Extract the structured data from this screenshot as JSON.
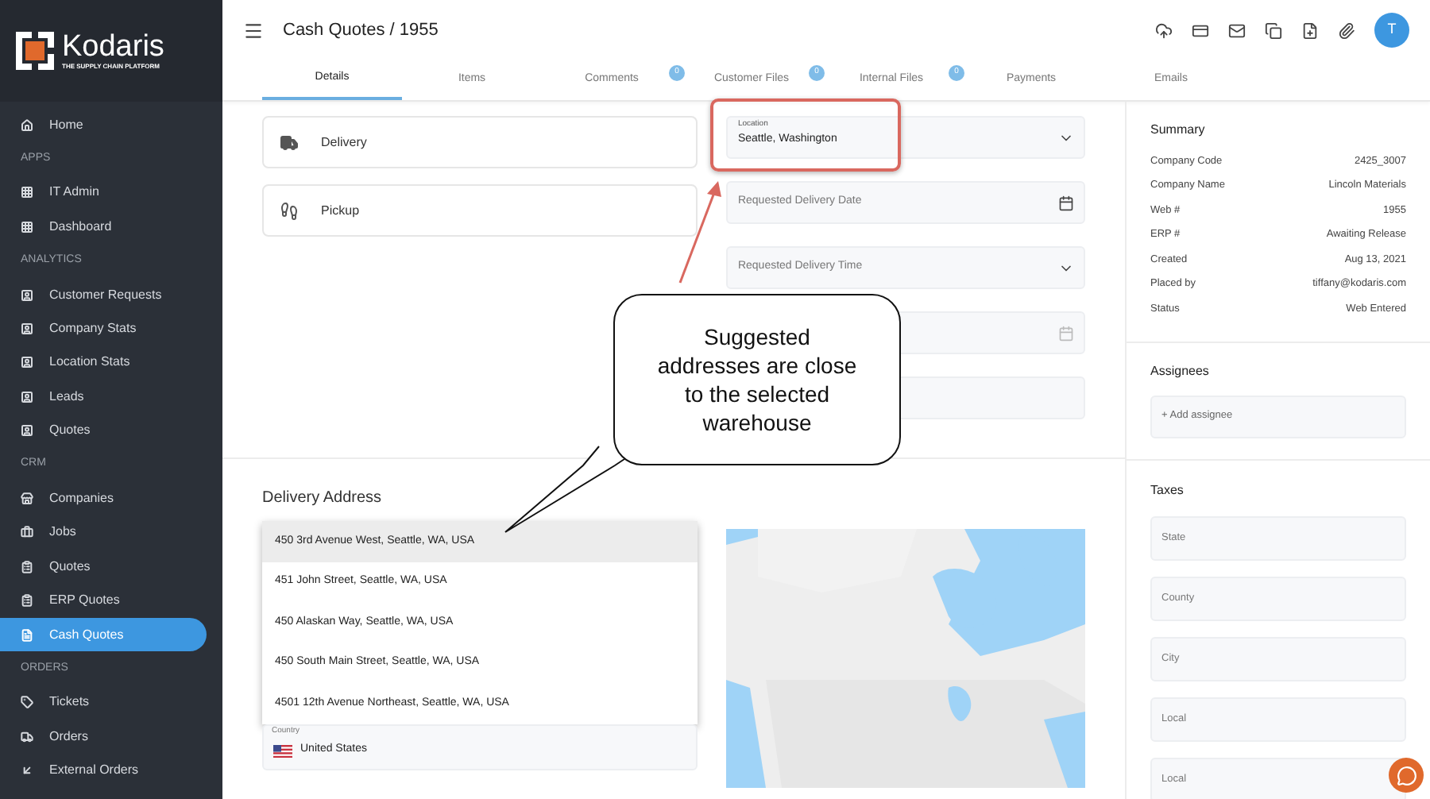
{
  "brand": {
    "logo": "Kodaris",
    "tagline": "THE SUPPLY CHAIN PLATFORM"
  },
  "sidebar": {
    "items": [
      {
        "kind": "item",
        "label": "Home",
        "selected": false
      },
      {
        "kind": "section",
        "label": "APPS"
      },
      {
        "kind": "item",
        "label": "IT Admin",
        "selected": false
      },
      {
        "kind": "item",
        "label": "Dashboard",
        "selected": false
      },
      {
        "kind": "section",
        "label": "ANALYTICS"
      },
      {
        "kind": "item",
        "label": "Customer Requests",
        "selected": false
      },
      {
        "kind": "item",
        "label": "Company Stats",
        "selected": false
      },
      {
        "kind": "item",
        "label": "Location Stats",
        "selected": false
      },
      {
        "kind": "item",
        "label": "Leads",
        "selected": false
      },
      {
        "kind": "item",
        "label": "Quotes",
        "selected": false
      },
      {
        "kind": "section",
        "label": "CRM"
      },
      {
        "kind": "item",
        "label": "Companies",
        "selected": false
      },
      {
        "kind": "item",
        "label": "Jobs",
        "selected": false
      },
      {
        "kind": "item",
        "label": "Quotes",
        "selected": false
      },
      {
        "kind": "item",
        "label": "ERP Quotes",
        "selected": false
      },
      {
        "kind": "item",
        "label": "Cash Quotes",
        "selected": true
      },
      {
        "kind": "section",
        "label": "ORDERS"
      },
      {
        "kind": "item",
        "label": "Tickets",
        "selected": false
      },
      {
        "kind": "item",
        "label": "Orders",
        "selected": false
      },
      {
        "kind": "item",
        "label": "External Orders",
        "selected": false
      }
    ]
  },
  "header": {
    "title": "Cash Quotes / 1955",
    "avatar": "T"
  },
  "tabs": [
    {
      "label": "Details",
      "selected": true
    },
    {
      "label": "Items",
      "selected": false
    },
    {
      "label": "Comments",
      "badge": "0",
      "selected": false
    },
    {
      "label": "Customer Files",
      "badge": "0",
      "selected": false
    },
    {
      "label": "Internal Files",
      "badge": "0",
      "selected": false
    },
    {
      "label": "Payments",
      "selected": false
    },
    {
      "label": "Emails",
      "selected": false
    }
  ],
  "delivery_options": [
    {
      "label": "Delivery"
    },
    {
      "label": "Pickup"
    }
  ],
  "fields": [
    {
      "kind": "select",
      "label": "Location",
      "value": "Seattle, Washington"
    },
    {
      "kind": "date",
      "placeholder": "Requested Delivery Date"
    },
    {
      "kind": "select",
      "placeholder": "Requested Delivery Time"
    },
    {
      "kind": "date"
    },
    {
      "kind": "text"
    }
  ],
  "delivery_address": {
    "title": "Delivery Address",
    "suggestions": [
      {
        "label": "450 3rd Avenue West, Seattle, WA, USA",
        "selected": true
      },
      {
        "label": "451 John Street, Seattle, WA, USA",
        "selected": false
      },
      {
        "label": "450 Alaskan Way, Seattle, WA, USA",
        "selected": false
      },
      {
        "label": "450 South Main Street, Seattle, WA, USA",
        "selected": false
      },
      {
        "label": "4501 12th Avenue Northeast, Seattle, WA, USA",
        "selected": false
      }
    ],
    "country": {
      "label": "Country",
      "value": "United States"
    }
  },
  "summary": {
    "title": "Summary",
    "rows": [
      {
        "label": "Company Code",
        "value": "2425_3007"
      },
      {
        "label": "Company Name",
        "value": "Lincoln Materials"
      },
      {
        "label": "Web #",
        "value": "1955"
      },
      {
        "label": "ERP #",
        "value": "Awaiting Release"
      },
      {
        "label": "Created",
        "value": "Aug 13, 2021"
      },
      {
        "label": "Placed by",
        "value": "tiffany@kodaris.com"
      },
      {
        "label": "Status",
        "value": "Web Entered"
      }
    ]
  },
  "assignees": {
    "title": "Assignees",
    "action": "+ Add assignee"
  },
  "taxes": {
    "title": "Taxes",
    "fields": [
      {
        "placeholder": "State"
      },
      {
        "placeholder": "County"
      },
      {
        "placeholder": "City"
      },
      {
        "placeholder": "Local"
      },
      {
        "placeholder": "Local"
      }
    ]
  },
  "callout": {
    "text": "Suggested addresses are close to the selected warehouse"
  }
}
